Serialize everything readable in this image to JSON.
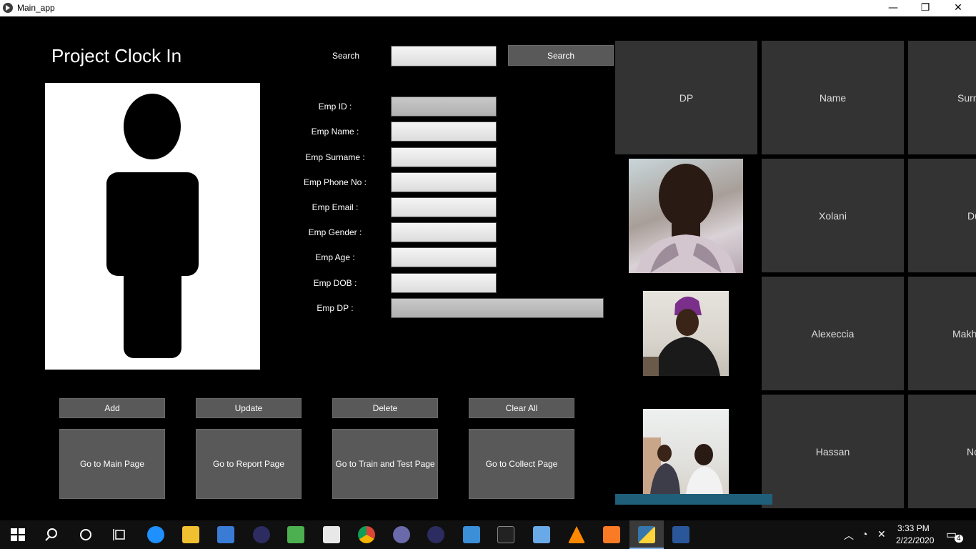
{
  "window": {
    "title": "Main_app",
    "minimize_glyph": "—",
    "restore_glyph": "❐",
    "close_glyph": "✕"
  },
  "header": {
    "title": "Project Clock In"
  },
  "search": {
    "label": "Search",
    "value": "",
    "button_label": "Search"
  },
  "form": {
    "fields": [
      {
        "label": "Emp ID :",
        "value": ""
      },
      {
        "label": "Emp Name :",
        "value": ""
      },
      {
        "label": "Emp Surname :",
        "value": ""
      },
      {
        "label": "Emp Phone No :",
        "value": ""
      },
      {
        "label": "Emp Email :",
        "value": ""
      },
      {
        "label": "Emp Gender :",
        "value": ""
      },
      {
        "label": "Emp Age :",
        "value": ""
      },
      {
        "label": "Emp DOB :",
        "value": ""
      },
      {
        "label": "Emp DP :",
        "value": ""
      }
    ]
  },
  "actions": {
    "add": "Add",
    "update": "Update",
    "delete": "Delete",
    "clear_all": "Clear All"
  },
  "navigation": {
    "main": "Go to Main Page",
    "report": "Go to Report Page",
    "train_test": "Go to Train and Test Page",
    "collect": "Go to Collect Page"
  },
  "table": {
    "headers": [
      "DP",
      "Name",
      "Surname"
    ],
    "rows": [
      {
        "name": "Xolani",
        "surname": "Du"
      },
      {
        "name": "Alexeccia",
        "surname": "Makh"
      },
      {
        "name": "Hassan",
        "surname": "Nc"
      }
    ]
  },
  "taskbar": {
    "time": "3:33 PM",
    "date": "2/22/2020",
    "notification_count": "4"
  },
  "colors": {
    "background": "#000000",
    "button": "#595959",
    "cell": "#333333",
    "scrollbar": "#1f5f7a",
    "taskbar": "#101010"
  }
}
